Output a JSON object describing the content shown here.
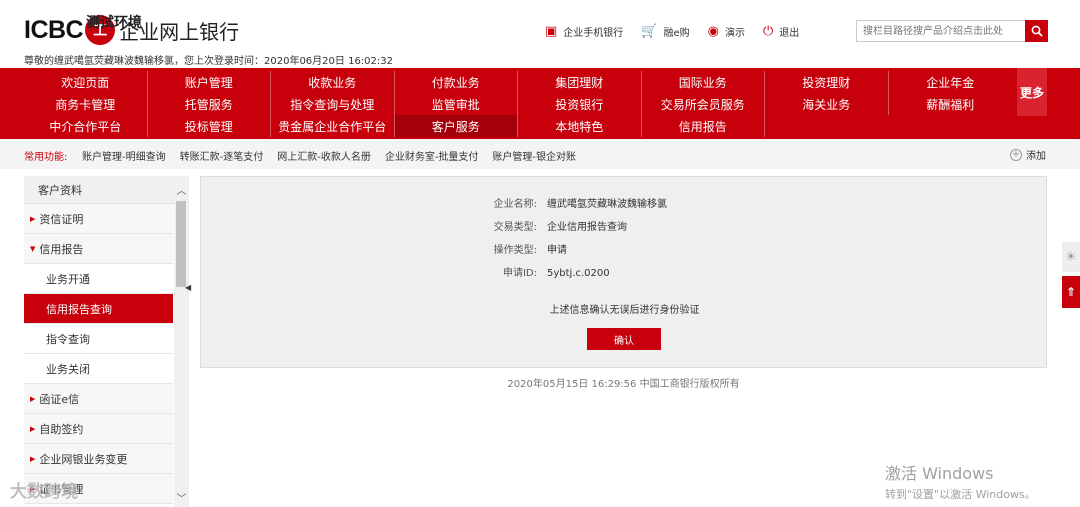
{
  "header": {
    "logo_text": "ICBC",
    "logo_mark": "工",
    "title": "企业网上银行",
    "env_tag": "测试环境",
    "welcome": "尊敬的缠武噶氩荧藏琳波魏输移氯，您上次登录时间：2020年06月20日 16:02:32",
    "links": [
      {
        "icon": "mobile-bank-icon",
        "glyph": "▣",
        "label": "企业手机银行"
      },
      {
        "icon": "cart-icon",
        "glyph": "🛒",
        "label": "融e购"
      },
      {
        "icon": "demo-icon",
        "glyph": "◉",
        "label": "演示"
      },
      {
        "icon": "power-icon",
        "glyph": "⏻",
        "label": "退出"
      }
    ],
    "search_placeholder": "搜栏目路径搜产品介绍点击此处"
  },
  "nav": {
    "items": [
      "欢迎页面",
      "账户管理",
      "收款业务",
      "付款业务",
      "集团理财",
      "国际业务",
      "投资理财",
      "企业年金",
      "商务卡管理",
      "托管服务",
      "指令查询与处理",
      "监管审批",
      "投资银行",
      "交易所会员服务",
      "海关业务",
      "薪酬福利",
      "中介合作平台",
      "投标管理",
      "贵金属企业合作平台",
      "客户服务",
      "本地特色",
      "信用报告"
    ],
    "active": "客户服务",
    "more": "更多"
  },
  "common": {
    "label": "常用功能:",
    "links": [
      "账户管理-明细查询",
      "转账汇款-逐笔支付",
      "网上汇款-收款人名册",
      "企业财务室-批量支付",
      "账户管理-银企对账"
    ],
    "add": "添加"
  },
  "sidebar": {
    "head": "客户资料",
    "items": [
      {
        "type": "item",
        "label": "资信证明"
      },
      {
        "type": "item",
        "label": "信用报告",
        "open": true
      },
      {
        "type": "sub",
        "label": "业务开通"
      },
      {
        "type": "sub",
        "label": "信用报告查询",
        "active": true
      },
      {
        "type": "sub",
        "label": "指令查询"
      },
      {
        "type": "sub",
        "label": "业务关闭"
      },
      {
        "type": "item",
        "label": "函证e信"
      },
      {
        "type": "item",
        "label": "自助签约"
      },
      {
        "type": "item",
        "label": "企业网银业务变更"
      },
      {
        "type": "item",
        "label": "证书管理"
      }
    ]
  },
  "panel": {
    "fields": [
      {
        "k": "企业名称:",
        "v": "缠武噶氩荧藏琳波魏输移氯"
      },
      {
        "k": "交易类型:",
        "v": "企业信用报告查询"
      },
      {
        "k": "操作类型:",
        "v": "申请"
      },
      {
        "k": "申请ID:",
        "v": "5ybtj.c.0200"
      }
    ],
    "confirm_text": "上述信息确认无误后进行身份验证",
    "confirm_btn": "确认"
  },
  "footer": "2020年05月15日 16:29:56    中国工商银行版权所有",
  "watermark": {
    "win1": "激活 Windows",
    "win2": "转到\"设置\"以激活 Windows。",
    "left": "大数跨境"
  }
}
